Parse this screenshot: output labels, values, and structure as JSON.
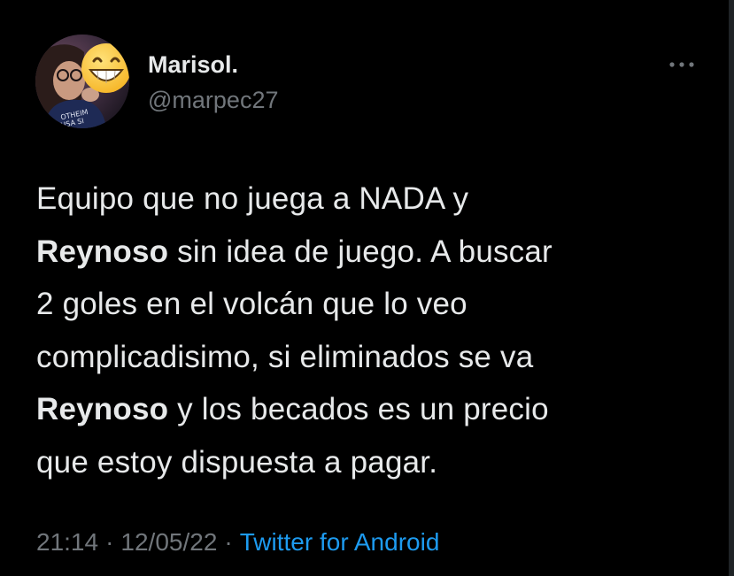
{
  "user": {
    "display_name": "Marisol.",
    "handle": "@marpec27"
  },
  "tweet": {
    "lines": [
      [
        {
          "text": "Equipo que no juega a NADA y",
          "bold": false
        }
      ],
      [
        {
          "text": "Reynoso",
          "bold": true
        },
        {
          "text": " sin idea de juego. A buscar",
          "bold": false
        }
      ],
      [
        {
          "text": "2 goles en el volcán que lo veo",
          "bold": false
        }
      ],
      [
        {
          "text": "complicadisimo, si eliminados se va",
          "bold": false
        }
      ],
      [
        {
          "text": "Reynoso",
          "bold": true
        },
        {
          "text": " y los becados es un precio",
          "bold": false
        }
      ],
      [
        {
          "text": "que estoy dispuesta a pagar.",
          "bold": false
        }
      ]
    ]
  },
  "meta": {
    "time": "21:14",
    "separator": "·",
    "date": "12/05/22",
    "source": "Twitter for Android"
  },
  "icons": {
    "more": "more-horizontal-icon",
    "avatar_sticker": "grinning-emoji-icon"
  },
  "colors": {
    "background": "#000000",
    "text_primary": "#e7e9ea",
    "text_secondary": "#71767b",
    "link": "#1d9bf0"
  }
}
